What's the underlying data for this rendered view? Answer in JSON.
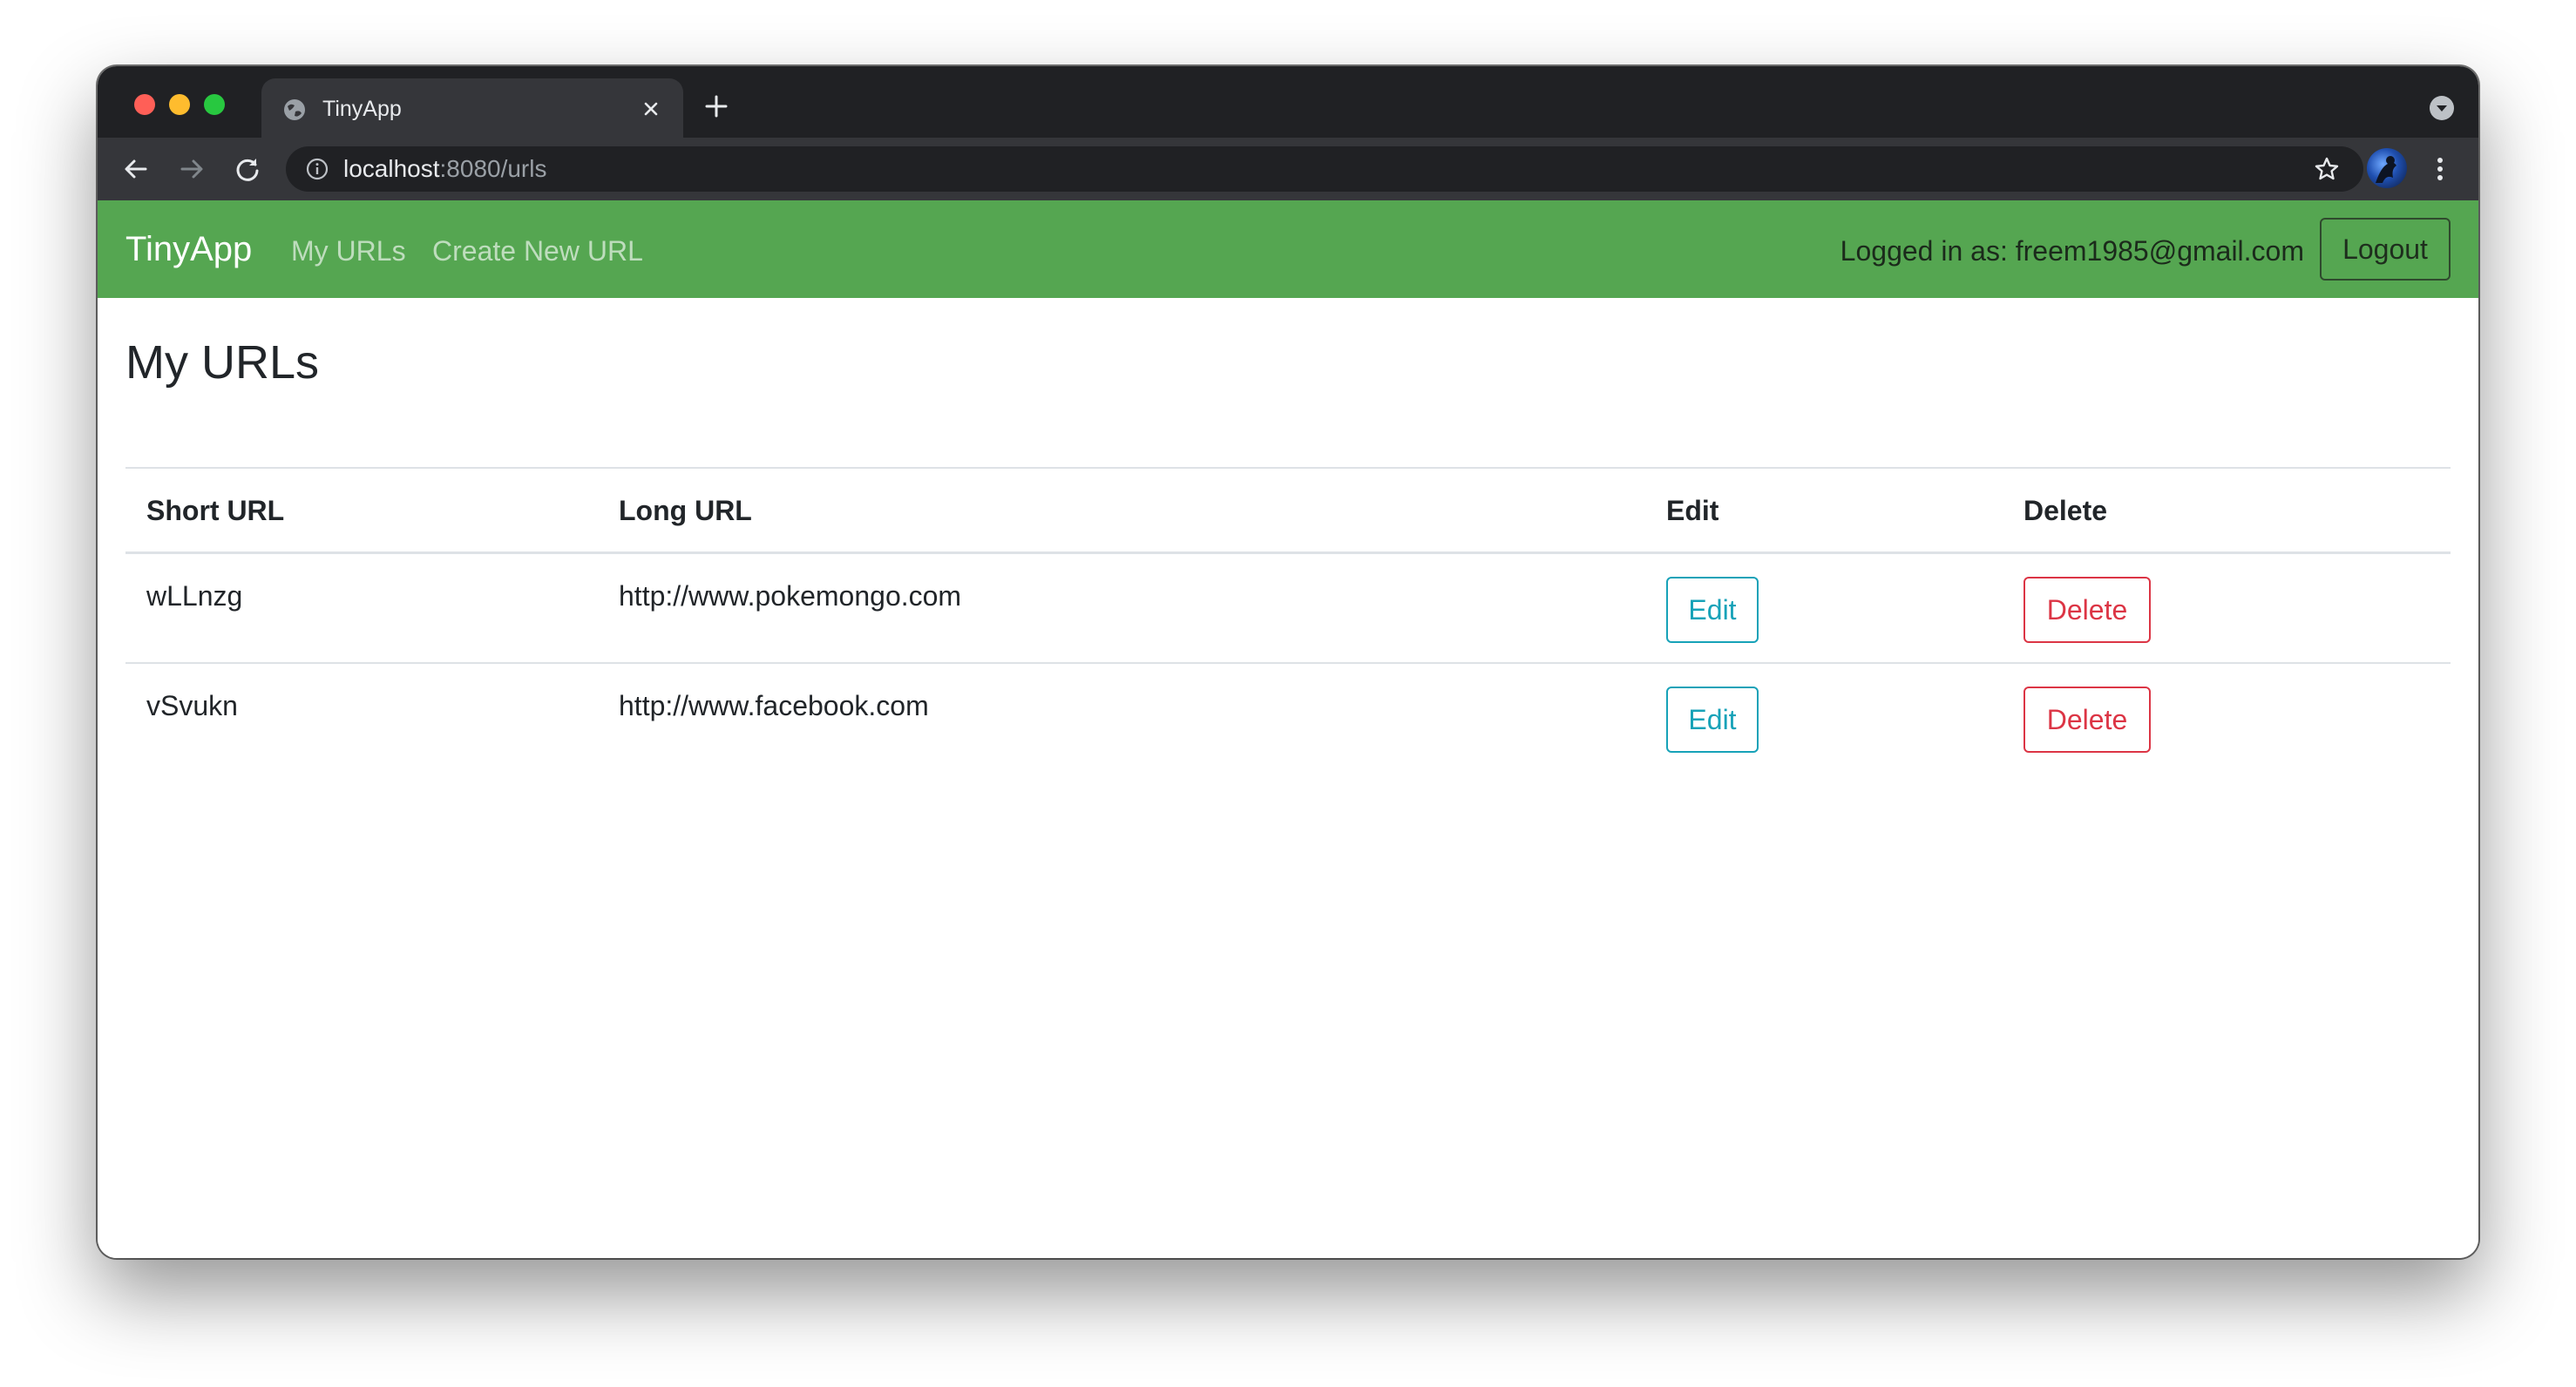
{
  "browser": {
    "tab": {
      "title": "TinyApp",
      "favicon_icon": "globe-icon",
      "close_icon": "close-icon"
    },
    "new_tab_icon": "plus-icon",
    "tab_search_icon": "chevron-down-circle-icon",
    "nav": {
      "back_icon": "arrow-left-icon",
      "forward_icon": "arrow-right-icon",
      "reload_icon": "reload-icon"
    },
    "address_bar": {
      "info_icon": "info-icon",
      "host": "localhost",
      "rest": ":8080/urls",
      "bookmark_icon": "star-icon"
    },
    "profile_icon": "avatar",
    "menu_icon": "kebab-menu-icon",
    "colors": {
      "chrome_dark": "#202124",
      "chrome_toolbar": "#35363a"
    }
  },
  "navbar": {
    "brand": "TinyApp",
    "links": [
      {
        "label": "My URLs"
      },
      {
        "label": "Create New URL"
      }
    ],
    "logged_in_text": "Logged in as: freem1985@gmail.com",
    "logout_label": "Logout",
    "color": "#55a651"
  },
  "main": {
    "heading": "My URLs",
    "table": {
      "headers": [
        "Short URL",
        "Long URL",
        "Edit",
        "Delete"
      ],
      "rows": [
        {
          "short_url": "wLLnzg",
          "long_url": "http://www.pokemongo.com",
          "edit_label": "Edit",
          "delete_label": "Delete"
        },
        {
          "short_url": "vSvukn",
          "long_url": "http://www.facebook.com",
          "edit_label": "Edit",
          "delete_label": "Delete"
        }
      ]
    },
    "colors": {
      "edit": "#17a2b8",
      "delete": "#dc3545"
    }
  }
}
